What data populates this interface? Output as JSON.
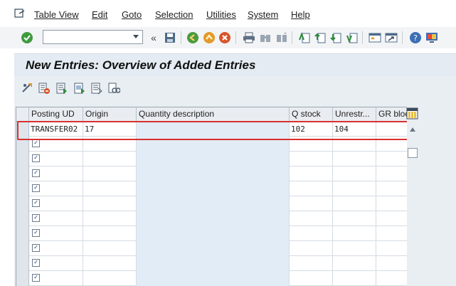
{
  "menubar": {
    "items": [
      {
        "label": "Table View",
        "name": "menu-table-view"
      },
      {
        "label": "Edit",
        "name": "menu-edit"
      },
      {
        "label": "Goto",
        "name": "menu-goto"
      },
      {
        "label": "Selection",
        "name": "menu-selection"
      },
      {
        "label": "Utilities",
        "name": "menu-utilities"
      },
      {
        "label": "System",
        "name": "menu-system"
      },
      {
        "label": "Help",
        "name": "menu-help"
      }
    ]
  },
  "toolbar": {
    "command_field_value": "",
    "buttons": [
      "enter-icon",
      "save-icon",
      "back-icon",
      "exit-icon",
      "cancel-icon",
      "print-icon",
      "find-icon",
      "find-next-icon",
      "first-page-icon",
      "previous-page-icon",
      "next-page-icon",
      "last-page-icon",
      "create-session-icon",
      "generate-shortcut-icon",
      "help-icon",
      "customize-layout-icon"
    ]
  },
  "page": {
    "title": "New Entries: Overview of Added Entries"
  },
  "app_toolbar": {
    "buttons": [
      "change-display-icon",
      "delete-icon",
      "select-all-icon",
      "select-block-icon",
      "deselect-all-icon",
      "print-list-icon"
    ]
  },
  "table": {
    "columns": [
      "Posting UD",
      "Origin",
      "Quantity description",
      "Q stock",
      "Unrestr...",
      "GR bloc"
    ],
    "rows": [
      {
        "posting_ud": "TRANSFER02",
        "origin": "17",
        "quantity_description": "",
        "q_stock": "102",
        "unrestricted": "104",
        "gr_blocked": ""
      },
      {
        "posting_ud": "",
        "checked": true
      },
      {
        "posting_ud": "",
        "checked": true
      },
      {
        "posting_ud": "",
        "checked": true
      },
      {
        "posting_ud": "",
        "checked": true
      },
      {
        "posting_ud": "",
        "checked": true
      },
      {
        "posting_ud": "",
        "checked": true
      },
      {
        "posting_ud": "",
        "checked": true
      },
      {
        "posting_ud": "",
        "checked": true
      },
      {
        "posting_ud": "",
        "checked": true
      },
      {
        "posting_ud": "",
        "checked": true
      }
    ]
  },
  "colors": {
    "accent_highlight": "#d9312f",
    "title_bg": "#e4ebf2",
    "qty_col_bg": "#e2ecf6"
  }
}
